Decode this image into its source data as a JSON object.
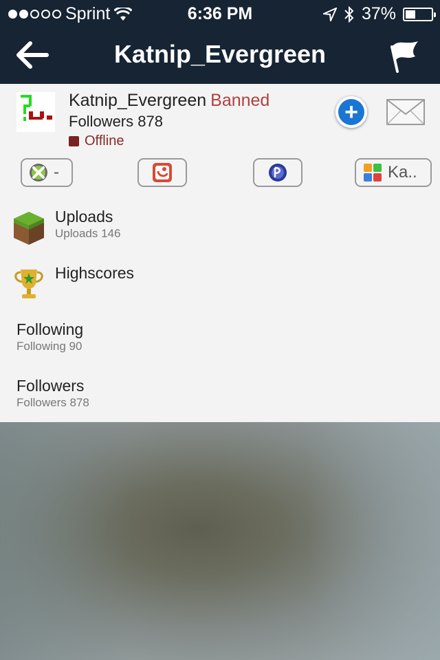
{
  "status_bar": {
    "carrier": "Sprint",
    "time": "6:36 PM",
    "battery": "37%",
    "battery_level": 0.37
  },
  "nav": {
    "title": "Katnip_Evergreen",
    "back_icon": "arrow-left-icon",
    "flag_icon": "flag-icon"
  },
  "profile": {
    "username": "Katnip_Evergreen",
    "status_tag": "Banned",
    "followers_text": "Followers 878",
    "presence": "Offline",
    "presence_color": "#7a2222",
    "banned_color": "#b0413e"
  },
  "accounts": [
    {
      "service": "xbox-icon",
      "label": "-"
    },
    {
      "service": "facebook-icon",
      "label": ""
    },
    {
      "service": "playstation-icon",
      "label": ""
    },
    {
      "service": "game-center-icon",
      "label": "Ka.."
    }
  ],
  "menu": {
    "uploads": {
      "title": "Uploads",
      "subtitle": "Uploads 146"
    },
    "highscores": {
      "title": "Highscores"
    },
    "following": {
      "title": "Following",
      "subtitle": "Following 90"
    },
    "followers": {
      "title": "Followers",
      "subtitle": "Followers 878"
    }
  },
  "colors": {
    "nav_bg": "#162434",
    "add_button": "#1a76d2"
  }
}
